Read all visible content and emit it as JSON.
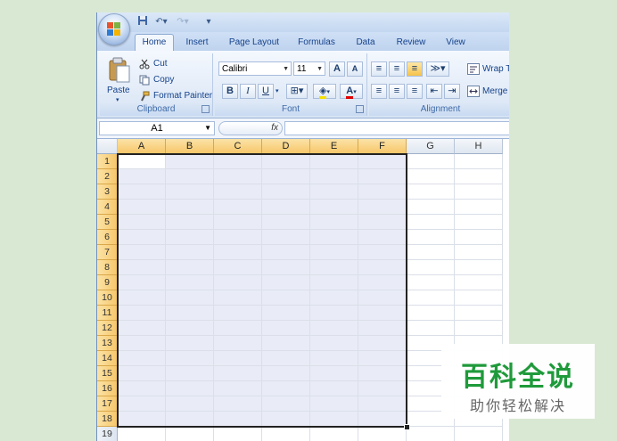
{
  "tabs": [
    "Home",
    "Insert",
    "Page Layout",
    "Formulas",
    "Data",
    "Review",
    "View"
  ],
  "active_tab": "Home",
  "clipboard": {
    "paste_label": "Paste",
    "cut_label": "Cut",
    "copy_label": "Copy",
    "format_painter_label": "Format Painter",
    "group_title": "Clipboard"
  },
  "font": {
    "font_name": "Calibri",
    "font_size": "11",
    "bold_label": "B",
    "italic_label": "I",
    "underline_label": "U",
    "grow_label": "A",
    "shrink_label": "A",
    "font_color_label": "A",
    "group_title": "Font"
  },
  "alignment": {
    "wrap_label": "Wrap T",
    "merge_label": "Merge",
    "group_title": "Alignment"
  },
  "formula_bar": {
    "name_box": "A1",
    "fx_label": "fx",
    "formula": ""
  },
  "columns": [
    "A",
    "B",
    "C",
    "D",
    "E",
    "F",
    "G",
    "H"
  ],
  "rows": [
    "1",
    "2",
    "3",
    "4",
    "5",
    "6",
    "7",
    "8",
    "9",
    "10",
    "11",
    "12",
    "13",
    "14",
    "15",
    "16",
    "17",
    "18",
    "19"
  ],
  "selection": {
    "range": "A1:F18",
    "active_cell": "A1"
  },
  "watermark": {
    "title": "百科全说",
    "subtitle": "助你轻松解决"
  },
  "colors": {
    "selection_fill": "#e9ecf6",
    "header_selected": "#f7c76a",
    "watermark_green": "#1f9a3b"
  }
}
